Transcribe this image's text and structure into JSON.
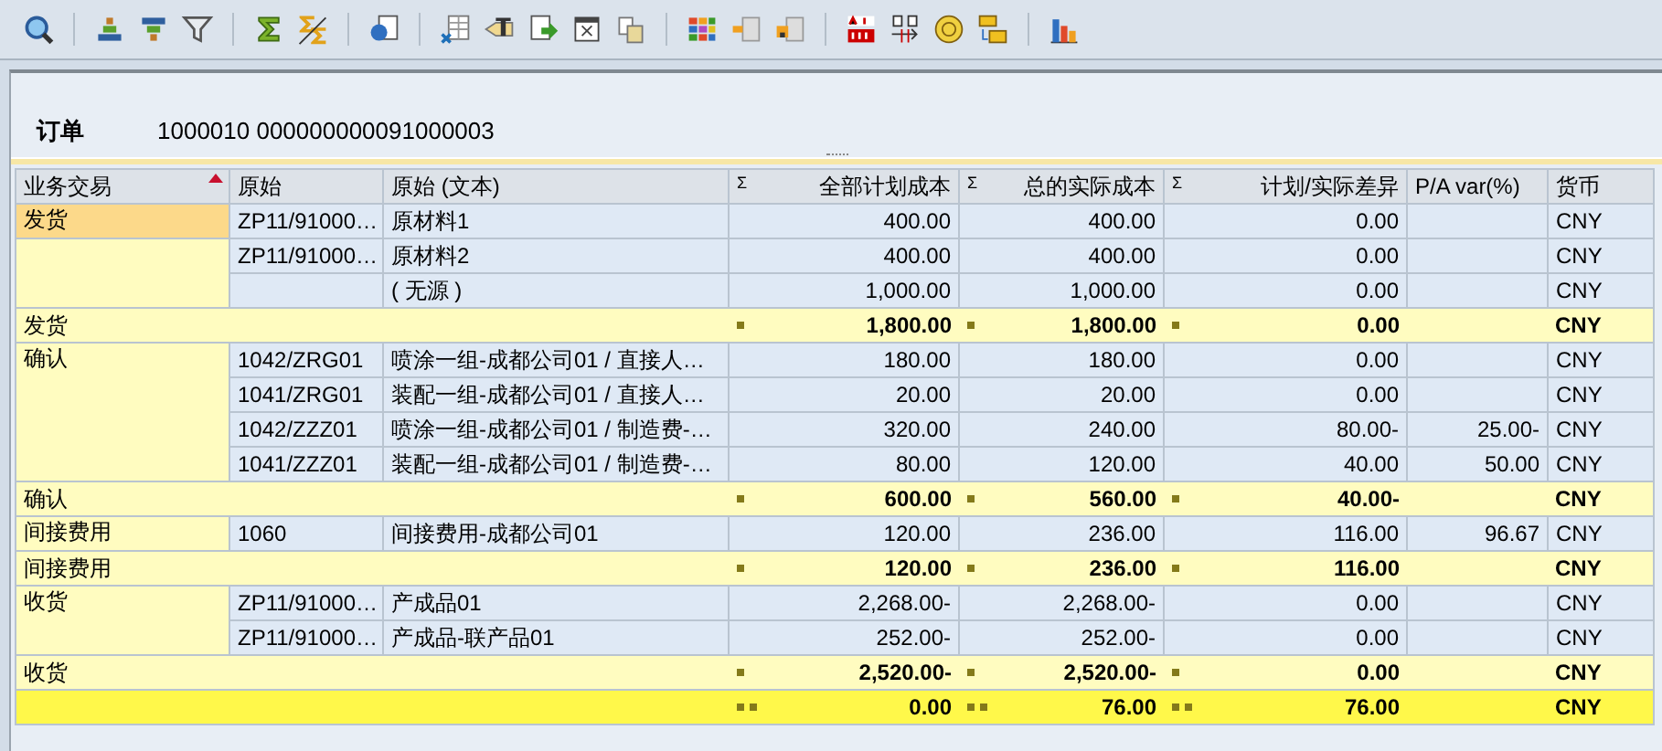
{
  "header": {
    "label": "订单",
    "value": "1000010 000000000091000003"
  },
  "columns": [
    {
      "label": "业务交易",
      "sorted": true
    },
    {
      "label": "原始",
      "sorted": false
    },
    {
      "label": "原始 (文本)",
      "sorted": false
    },
    {
      "label": "全部计划成本",
      "sum_mark": "Σ",
      "sorted": false
    },
    {
      "label": "总的实际成本",
      "sum_mark": "Σ",
      "sorted": false
    },
    {
      "label": "计划/实际差异",
      "sum_mark": "Σ",
      "sorted": false
    },
    {
      "label": "P/A var(%)",
      "sorted": false
    },
    {
      "label": "货币",
      "sorted": false
    }
  ],
  "groups": [
    {
      "label": "发货",
      "selected": true,
      "items": [
        {
          "origin": "ZP11/91000…",
          "origin_text": "原材料1",
          "plan": "400.00",
          "actual": "400.00",
          "variance": "0.00",
          "currency": "CNY"
        },
        {
          "origin": "ZP11/91000…",
          "origin_text": "原材料2",
          "plan": "400.00",
          "actual": "400.00",
          "variance": "0.00",
          "currency": "CNY"
        },
        {
          "origin_text": "( 无源 )",
          "plan": "1,000.00",
          "actual": "1,000.00",
          "variance": "0.00",
          "currency": "CNY"
        }
      ],
      "subtotal": {
        "label": "发货",
        "plan": "1,800.00",
        "actual": "1,800.00",
        "variance": "0.00",
        "currency": "CNY"
      }
    },
    {
      "label": "确认",
      "selected": false,
      "items": [
        {
          "origin": "1042/ZRG01",
          "origin_text": "喷涂一组-成都公司01 / 直接人…",
          "plan": "180.00",
          "actual": "180.00",
          "variance": "0.00",
          "currency": "CNY"
        },
        {
          "origin": "1041/ZRG01",
          "origin_text": "装配一组-成都公司01 / 直接人…",
          "plan": "20.00",
          "actual": "20.00",
          "variance": "0.00",
          "currency": "CNY"
        },
        {
          "origin": "1042/ZZZ01",
          "origin_text": "喷涂一组-成都公司01 / 制造费-…",
          "plan": "320.00",
          "actual": "240.00",
          "variance": "80.00-",
          "pa_var": "25.00-",
          "currency": "CNY"
        },
        {
          "origin": "1041/ZZZ01",
          "origin_text": "装配一组-成都公司01 / 制造费-…",
          "plan": "80.00",
          "actual": "120.00",
          "variance": "40.00",
          "pa_var": "50.00",
          "currency": "CNY"
        }
      ],
      "subtotal": {
        "label": "确认",
        "plan": "600.00",
        "actual": "560.00",
        "variance": "40.00-",
        "currency": "CNY"
      }
    },
    {
      "label": "间接费用",
      "selected": false,
      "items": [
        {
          "origin": "1060",
          "origin_text": "间接费用-成都公司01",
          "plan": "120.00",
          "actual": "236.00",
          "variance": "116.00",
          "pa_var": "96.67",
          "currency": "CNY"
        }
      ],
      "subtotal": {
        "label": "间接费用",
        "plan": "120.00",
        "actual": "236.00",
        "variance": "116.00",
        "currency": "CNY"
      }
    },
    {
      "label": "收货",
      "selected": false,
      "items": [
        {
          "origin": "ZP11/91000…",
          "origin_text": "产成品01",
          "plan": "2,268.00-",
          "actual": "2,268.00-",
          "variance": "0.00",
          "currency": "CNY"
        },
        {
          "origin": "ZP11/91000…",
          "origin_text": "产成品-联产品01",
          "plan": "252.00-",
          "actual": "252.00-",
          "variance": "0.00",
          "currency": "CNY"
        }
      ],
      "subtotal": {
        "label": "收货",
        "plan": "2,520.00-",
        "actual": "2,520.00-",
        "variance": "0.00",
        "currency": "CNY"
      }
    }
  ],
  "total": {
    "plan": "0.00",
    "actual": "76.00",
    "variance": "76.00",
    "currency": "CNY"
  }
}
